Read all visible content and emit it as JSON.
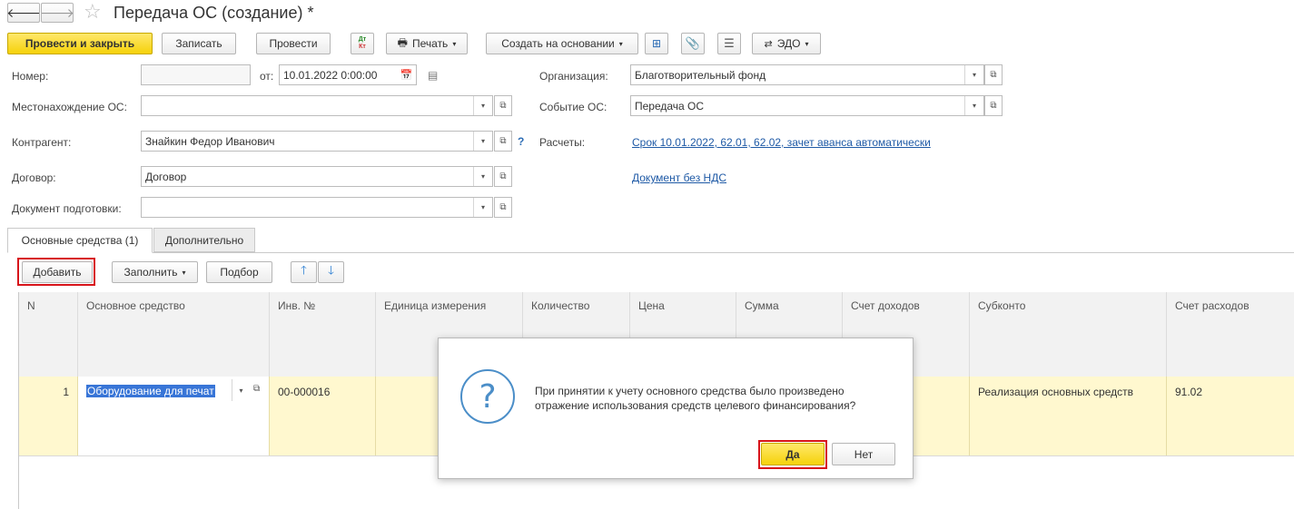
{
  "window": {
    "title": "Передача ОС (создание) *"
  },
  "toolbar": {
    "post_close": "Провести и закрыть",
    "save": "Записать",
    "post": "Провести",
    "dtkt": "Дт Кт",
    "print": "Печать",
    "create_based": "Создать на основании",
    "edo": "ЭДО"
  },
  "form": {
    "number_label": "Номер:",
    "number_value": "",
    "date_label": "от:",
    "date_value": "10.01.2022  0:00:00",
    "location_label": "Местонахождение ОС:",
    "location_value": "",
    "counterparty_label": "Контрагент:",
    "counterparty_value": "Знайкин Федор Иванович",
    "counterparty_help": "?",
    "contract_label": "Договор:",
    "contract_value": "Договор",
    "prep_doc_label": "Документ подготовки:",
    "prep_doc_value": "",
    "org_label": "Организация:",
    "org_value": "Благотворительный фонд",
    "event_label": "Событие ОС:",
    "event_value": "Передача ОС",
    "settlements_label": "Расчеты:",
    "settlements_link": "Срок 10.01.2022, 62.01, 62.02, зачет аванса автоматически",
    "vat_link": "Документ без НДС"
  },
  "tabs": [
    {
      "label": "Основные средства (1)"
    },
    {
      "label": "Дополнительно"
    }
  ],
  "table_toolbar": {
    "add": "Добавить",
    "fill": "Заполнить",
    "select": "Подбор"
  },
  "table": {
    "columns": [
      "N",
      "Основное средство",
      "Инв. №",
      "Единица измерения",
      "Количество",
      "Цена",
      "Сумма",
      "Счет доходов",
      "Субконто",
      "Счет расходов"
    ],
    "rows": [
      {
        "n": "1",
        "asset": "Оборудование для печат",
        "inv": "00-000016",
        "unit": "",
        "qty": "",
        "price": "",
        "sum": "",
        "income_account": "",
        "subconto": "Реализация основных средств",
        "expense_account": "91.02"
      }
    ]
  },
  "dialog": {
    "message_line1": "При принятии к учету основного средства было произведено",
    "message_line2": "отражение использования средств целевого финансирования?",
    "yes": "Да",
    "no": "Нет"
  },
  "colors": {
    "accent_yellow": "#f5d20a",
    "highlight_red": "#d7141a",
    "link_blue": "#1f5aa6",
    "row_yellow": "#fff8cf"
  }
}
